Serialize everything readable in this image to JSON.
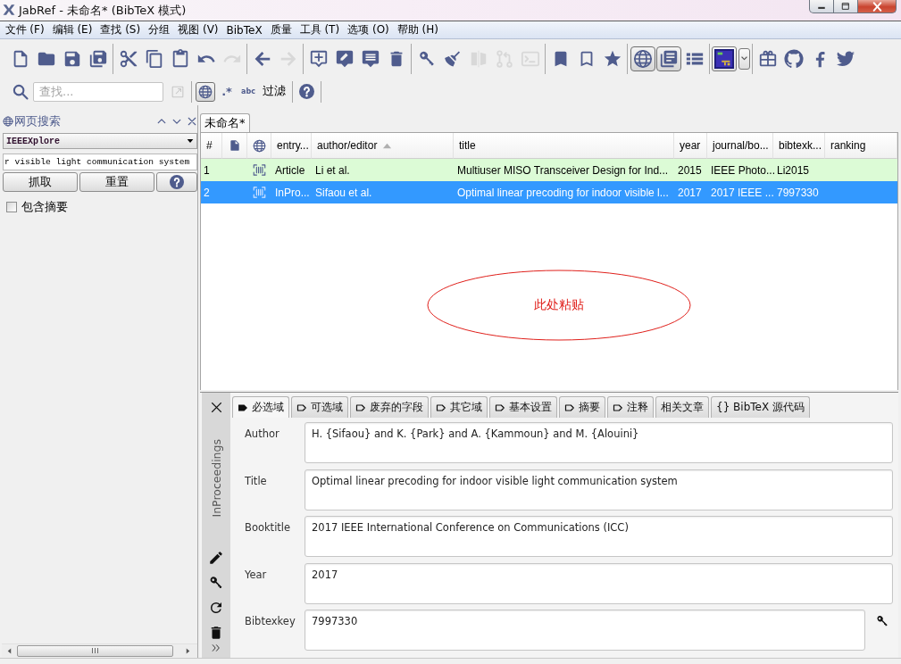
{
  "window": {
    "title": "JabRef - 未命名* (BibTeX 模式)"
  },
  "menu": [
    "文件 (F)",
    "编辑 (E)",
    "查找 (S)",
    "分组",
    "视图 (V)",
    "BibTeX",
    "质量",
    "工具 (T)",
    "选项 (O)",
    "帮助 (H)"
  ],
  "toolbar": {
    "groups": [
      [
        {
          "kind": "new",
          "disabled": false,
          "pressed": false
        },
        {
          "kind": "open",
          "disabled": false,
          "pressed": false
        },
        {
          "kind": "save",
          "disabled": false,
          "pressed": false
        },
        {
          "kind": "saveall",
          "disabled": false,
          "pressed": false
        }
      ],
      [
        {
          "kind": "cut",
          "disabled": false,
          "pressed": false
        },
        {
          "kind": "copy",
          "disabled": false,
          "pressed": false
        },
        {
          "kind": "paste",
          "disabled": false,
          "pressed": false
        },
        {
          "kind": "undo",
          "disabled": false,
          "pressed": false
        },
        {
          "kind": "redo",
          "disabled": true,
          "pressed": false
        }
      ],
      [
        {
          "kind": "back",
          "disabled": false,
          "pressed": false
        },
        {
          "kind": "forward",
          "disabled": true,
          "pressed": false
        }
      ],
      [
        {
          "kind": "addentry",
          "disabled": false,
          "pressed": false
        },
        {
          "kind": "editentry",
          "disabled": false,
          "pressed": false
        },
        {
          "kind": "comment",
          "disabled": false,
          "pressed": false
        },
        {
          "kind": "delete",
          "disabled": false,
          "pressed": false
        }
      ],
      [
        {
          "kind": "key",
          "disabled": false,
          "pressed": false
        },
        {
          "kind": "cleanup",
          "disabled": false,
          "pressed": false
        },
        {
          "kind": "merge",
          "disabled": true,
          "pressed": false
        },
        {
          "kind": "compare",
          "disabled": true,
          "pressed": false
        },
        {
          "kind": "terminal",
          "disabled": true,
          "pressed": false
        }
      ],
      [
        {
          "kind": "mark",
          "disabled": false,
          "pressed": false
        },
        {
          "kind": "unmark",
          "disabled": false,
          "pressed": false
        },
        {
          "kind": "star",
          "disabled": false,
          "pressed": false
        }
      ],
      [
        {
          "kind": "web",
          "disabled": false,
          "pressed": true
        },
        {
          "kind": "editor",
          "disabled": false,
          "pressed": true
        },
        {
          "kind": "list",
          "disabled": false,
          "pressed": false
        }
      ],
      [
        {
          "kind": "texstudio",
          "disabled": false,
          "pressed": false
        },
        {
          "kind": "dropdown",
          "disabled": false,
          "pressed": false
        }
      ],
      [
        {
          "kind": "gift",
          "disabled": false,
          "pressed": false
        },
        {
          "kind": "github",
          "disabled": false,
          "pressed": false
        },
        {
          "kind": "facebook",
          "disabled": false,
          "pressed": false
        },
        {
          "kind": "twitter",
          "disabled": false,
          "pressed": false
        }
      ]
    ]
  },
  "search": {
    "placeholder": "查找...",
    "groups": [
      [
        {
          "kind": "open",
          "disabled": true
        }
      ],
      [
        {
          "kind": "global",
          "pressed": true
        },
        {
          "kind": "regex",
          "label": ".*",
          "pressed": false
        },
        {
          "kind": "case",
          "label": "abc",
          "pressed": false
        },
        {
          "kind": "filter",
          "label": "过滤",
          "pressed": false
        }
      ],
      [
        {
          "kind": "help"
        }
      ]
    ]
  },
  "web_search": {
    "title": "网页搜索",
    "engine": "IEEEXplore",
    "query": "r visible light communication system",
    "buttons": [
      "抓取",
      "重置"
    ],
    "include_abstract": {
      "label": "包含摘要",
      "checked": false
    }
  },
  "library_tabs": [
    {
      "label": "未命名*",
      "selected": true
    }
  ],
  "table": {
    "columns": [
      {
        "kind": "text",
        "label": "#",
        "sorted": false
      },
      {
        "kind": "file",
        "sorted": false
      },
      {
        "kind": "link",
        "sorted": false
      },
      {
        "kind": "text",
        "label": "entry...",
        "sorted": false
      },
      {
        "kind": "text",
        "label": "author/editor",
        "sorted": true
      },
      {
        "kind": "text",
        "label": "title",
        "sorted": false
      },
      {
        "kind": "text",
        "label": "year",
        "sorted": false
      },
      {
        "kind": "text",
        "label": "journal/bo...",
        "sorted": false
      },
      {
        "kind": "text",
        "label": "bibtexk...",
        "sorted": false
      },
      {
        "kind": "text",
        "label": "ranking",
        "sorted": false
      }
    ],
    "rows": [
      {
        "cells": [
          "1",
          "",
          "",
          "Article",
          "Li et al.",
          "Multiuser MISO Transceiver Design for Ind...",
          "2015",
          "IEEE Photo...",
          "Li2015"
        ],
        "link": true,
        "selected": false,
        "matched": true
      },
      {
        "cells": [
          "2",
          "",
          "",
          "InPro...",
          "Sifaou et al.",
          "Optimal linear precoding for indoor visible l...",
          "2017",
          "2017 IEEE ...",
          "7997330"
        ],
        "link": true,
        "selected": true,
        "matched": false
      }
    ],
    "annotation": {
      "text": "此处粘贴"
    }
  },
  "entry_editor": {
    "tabs": [
      {
        "label": "必选域",
        "kind": "required",
        "selected": true
      },
      {
        "label": "可选域",
        "kind": "optional",
        "selected": false
      },
      {
        "label": "废弃的字段",
        "kind": "optional",
        "selected": false
      },
      {
        "label": "其它域",
        "kind": "optional",
        "selected": false
      },
      {
        "label": "基本设置",
        "kind": "optional",
        "selected": false
      },
      {
        "label": "摘要",
        "kind": "optional",
        "selected": false
      },
      {
        "label": "注释",
        "kind": "optional",
        "selected": false
      },
      {
        "label": "相关文章",
        "kind": "plain",
        "selected": false
      },
      {
        "label": "{} BibTeX 源代码",
        "kind": "plain",
        "selected": false
      }
    ],
    "entry_type": "InProceedings",
    "fields": [
      {
        "label": "Author",
        "value": "H. {Sifaou} and K. {Park} and A. {Kammoun} and M. {Alouini}",
        "kind": "text"
      },
      {
        "label": "Title",
        "value": "Optimal linear precoding for indoor visible light communication system",
        "kind": "text"
      },
      {
        "label": "Booktitle",
        "value": "2017 IEEE International Conference on Communications (ICC)",
        "kind": "text"
      },
      {
        "label": "Year",
        "value": "2017",
        "kind": "text"
      },
      {
        "label": "Bibtexkey",
        "value": "7997330",
        "kind": "key"
      }
    ]
  }
}
